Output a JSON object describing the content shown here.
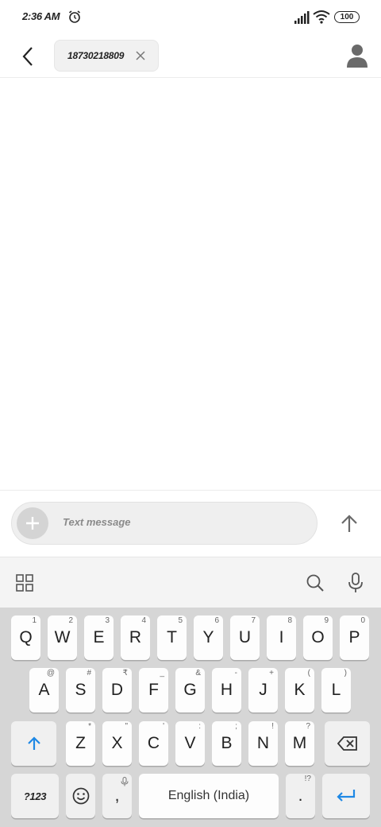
{
  "status_bar": {
    "time": "2:36 AM",
    "battery": "100"
  },
  "header": {
    "recipient": "18730218809"
  },
  "compose": {
    "placeholder": "Text message"
  },
  "keyboard": {
    "row1": [
      {
        "key": "Q",
        "hint": "1"
      },
      {
        "key": "W",
        "hint": "2"
      },
      {
        "key": "E",
        "hint": "3"
      },
      {
        "key": "R",
        "hint": "4"
      },
      {
        "key": "T",
        "hint": "5"
      },
      {
        "key": "Y",
        "hint": "6"
      },
      {
        "key": "U",
        "hint": "7"
      },
      {
        "key": "I",
        "hint": "8"
      },
      {
        "key": "O",
        "hint": "9"
      },
      {
        "key": "P",
        "hint": "0"
      }
    ],
    "row2": [
      {
        "key": "A",
        "hint": "@"
      },
      {
        "key": "S",
        "hint": "#"
      },
      {
        "key": "D",
        "hint": "₹"
      },
      {
        "key": "F",
        "hint": "_"
      },
      {
        "key": "G",
        "hint": "&"
      },
      {
        "key": "H",
        "hint": "-"
      },
      {
        "key": "J",
        "hint": "+"
      },
      {
        "key": "K",
        "hint": "("
      },
      {
        "key": "L",
        "hint": ")"
      }
    ],
    "row3": [
      {
        "key": "Z",
        "hint": "*"
      },
      {
        "key": "X",
        "hint": "\""
      },
      {
        "key": "C",
        "hint": "'"
      },
      {
        "key": "V",
        "hint": ":"
      },
      {
        "key": "B",
        "hint": ";"
      },
      {
        "key": "N",
        "hint": "!"
      },
      {
        "key": "M",
        "hint": "?"
      }
    ],
    "symbols_label": "?123",
    "comma": ",",
    "space_label": "English (India)",
    "period": ".",
    "period_hint": "!?"
  },
  "colors": {
    "accent": "#1e88e5",
    "keyboard_bg": "#d6d6d6"
  },
  "icons": [
    "back-arrow-icon",
    "close-icon",
    "contact-person-icon",
    "alarm-icon",
    "signal-icon",
    "wifi-icon",
    "plus-icon",
    "send-arrow-icon",
    "grid-icon",
    "search-icon",
    "mic-icon",
    "shift-icon",
    "backspace-icon",
    "emoji-icon",
    "enter-icon"
  ]
}
